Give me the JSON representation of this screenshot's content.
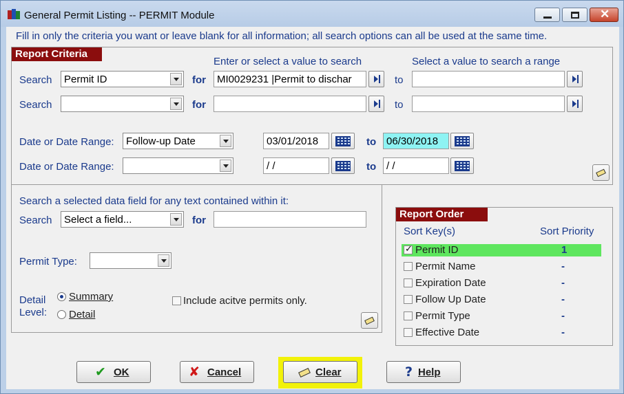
{
  "window": {
    "title": "General Permit Listing -- PERMIT Module"
  },
  "hint": "Fill in only the criteria you want or leave blank for all information; all search options can all be used at the same time.",
  "report_criteria": {
    "title": "Report Criteria",
    "value_header": "Enter or select a value to search",
    "range_header": "Select a value to search a range",
    "search_label": "Search",
    "for_label": "for",
    "to_label": "to",
    "search_rows": [
      {
        "field": "Permit ID",
        "value": "MI0029231   |Permit to dischar",
        "range": ""
      },
      {
        "field": "",
        "value": "",
        "range": ""
      }
    ],
    "date_label": "Date or Date Range:",
    "date_rows": [
      {
        "field": "Follow-up Date",
        "from": "03/01/2018",
        "to": "06/30/2018"
      },
      {
        "field": "",
        "from": " / /",
        "to": " / /"
      }
    ]
  },
  "text_search": {
    "heading": "Search a selected data field for any text contained within it:",
    "search_label": "Search",
    "field": "Select a field...",
    "for_label": "for",
    "value": ""
  },
  "permit_type": {
    "label": "Permit Type:",
    "value": ""
  },
  "detail_level": {
    "label_line1": "Detail",
    "label_line2": "Level:",
    "options": [
      "Summary",
      "Detail"
    ],
    "selected": "Summary"
  },
  "include_active": {
    "label": "Include acitve permits only.",
    "checked": false
  },
  "report_order": {
    "title": "Report Order",
    "sort_keys_header": "Sort Key(s)",
    "priority_header": "Sort Priority",
    "rows": [
      {
        "name": "Permit ID",
        "checked": true,
        "priority": "1"
      },
      {
        "name": "Permit Name",
        "checked": false,
        "priority": "-"
      },
      {
        "name": "Expiration Date",
        "checked": false,
        "priority": "-"
      },
      {
        "name": "Follow Up Date",
        "checked": false,
        "priority": "-"
      },
      {
        "name": "Permit Type",
        "checked": false,
        "priority": "-"
      },
      {
        "name": "Effective Date",
        "checked": false,
        "priority": "-"
      }
    ]
  },
  "buttons": {
    "ok": "OK",
    "cancel": "Cancel",
    "clear": "Clear",
    "help": "Help"
  },
  "colors": {
    "group_title_bg": "#8b0d0d",
    "label_blue": "#1a3a8c",
    "selected_row": "#5ee65e",
    "active_input": "#8ef3f3",
    "focus_highlight": "#f2f20a"
  },
  "icons": {
    "ok": "checkmark-icon",
    "cancel": "x-icon",
    "clear": "eraser-icon",
    "help": "question-icon",
    "lookup": "lookup-arrow-icon",
    "calendar": "calendar-icon"
  }
}
